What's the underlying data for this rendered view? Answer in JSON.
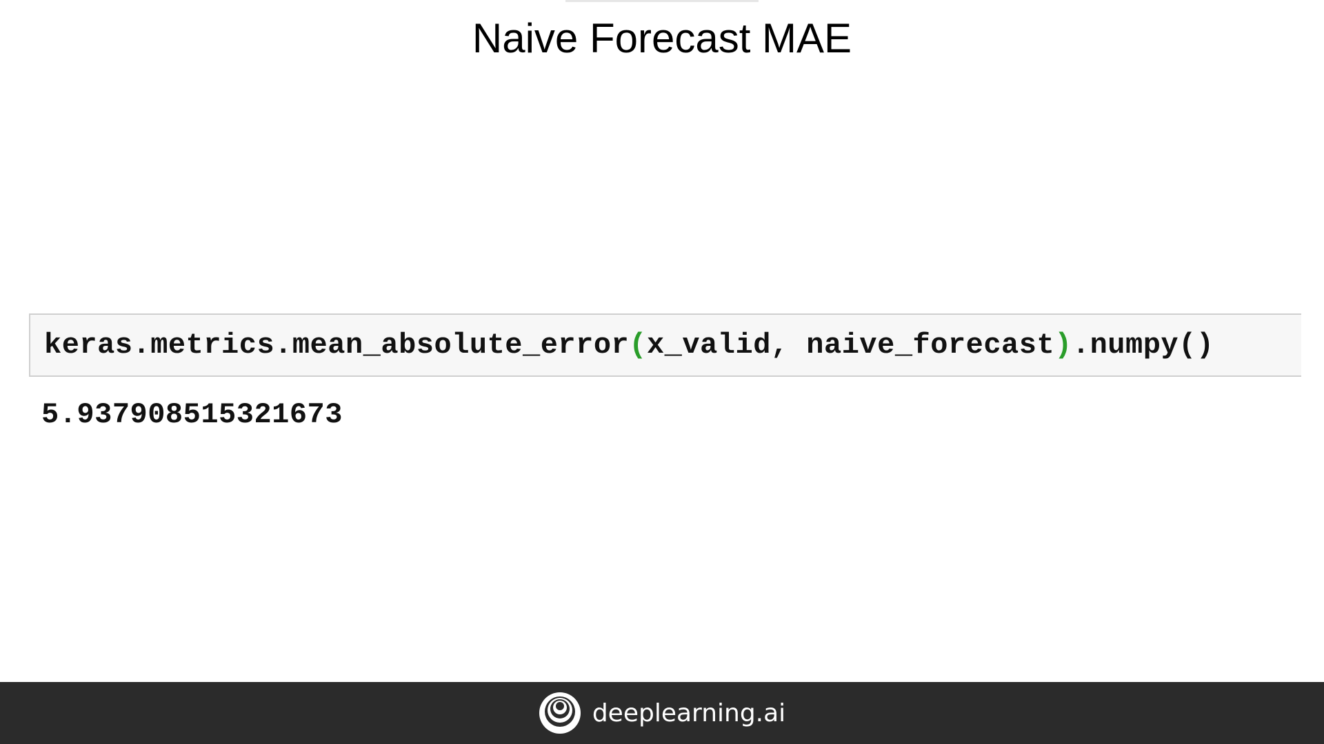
{
  "slide": {
    "title": "Naive Forecast MAE"
  },
  "code_cell": {
    "fn": "keras.metrics.mean_absolute_error",
    "open_paren": "(",
    "args": "x_valid, naive_forecast",
    "close_paren": ")",
    "suffix": ".numpy()",
    "paren_color": "#2a9d2a"
  },
  "output": {
    "value": "5.937908515321673"
  },
  "footer": {
    "brand": "deeplearning.ai",
    "logo_icon": "deeplearning-logo-icon"
  }
}
